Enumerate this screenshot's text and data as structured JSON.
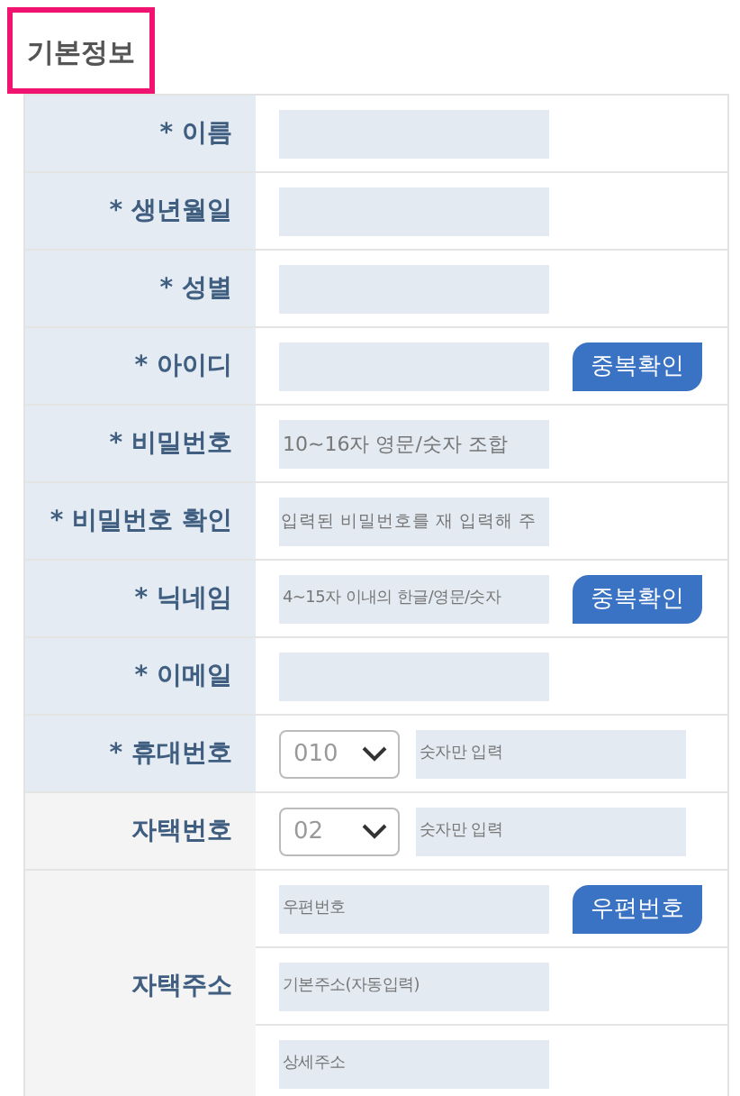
{
  "section_title": "기본정보",
  "rows": [
    {
      "kind": "text",
      "label": "* 이름",
      "required": true
    },
    {
      "kind": "text",
      "label": "* 생년월일",
      "required": true
    },
    {
      "kind": "text",
      "label": "* 성별",
      "required": true
    },
    {
      "kind": "text_button",
      "label": "* 아이디",
      "required": true,
      "button": "중복확인"
    },
    {
      "kind": "text",
      "label": "* 비밀번호",
      "required": true,
      "placeholder": "10~16자 영문/숫자 조합"
    },
    {
      "kind": "text",
      "label": "* 비밀번호 확인",
      "required": true,
      "placeholder": "입력된 비밀번호를 재 입력해 주"
    },
    {
      "kind": "text_button",
      "label": "* 닉네임",
      "required": true,
      "placeholder": "4~15자 이내의 한글/영문/숫자",
      "button": "중복확인"
    },
    {
      "kind": "text",
      "label": "* 이메일",
      "required": true
    },
    {
      "kind": "phone",
      "label": "* 휴대번호",
      "required": true,
      "select": "010",
      "placeholder": "숫자만 입력"
    },
    {
      "kind": "phone",
      "label": "자택번호",
      "required": false,
      "select": "02",
      "placeholder": "숫자만 입력"
    },
    {
      "kind": "address",
      "label": "자택주소",
      "required": false,
      "fields": [
        {
          "placeholder": "우편번호",
          "button": "우편번호"
        },
        {
          "placeholder": "기본주소(자동입력)"
        },
        {
          "placeholder": "상세주소"
        }
      ]
    }
  ]
}
